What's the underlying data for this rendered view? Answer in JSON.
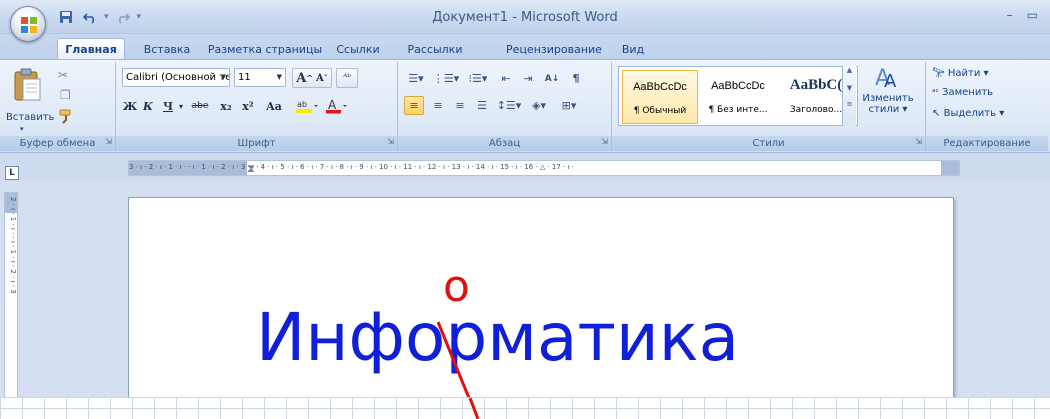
{
  "window": {
    "title": "Документ1 - Microsoft Word",
    "minimize_glyph": "–",
    "restore_glyph": "▭"
  },
  "quick_access": {
    "save_icon": "save-icon",
    "undo_icon": "undo-icon",
    "redo_icon": "redo-icon",
    "customize_glyph": "▾"
  },
  "tabs": [
    "Главная",
    "Вставка",
    "Разметка страницы",
    "Ссылки",
    "Рассылки",
    "Рецензирование",
    "Вид"
  ],
  "active_tab": "Главная",
  "clipboard": {
    "paste_label": "Вставить",
    "paste_arrow": "▾",
    "group_label": "Буфер обмена"
  },
  "font": {
    "font_name": "Calibri (Основной те",
    "font_size": "11",
    "grow": "A",
    "shrink": "A",
    "bold": "Ж",
    "italic": "К",
    "underline": "Ч",
    "strike": "abe",
    "subscript": "x₂",
    "superscript": "x²",
    "case": "Aa",
    "group_label": "Шрифт"
  },
  "paragraph": {
    "group_label": "Абзац"
  },
  "styles": {
    "items": [
      {
        "sample": "AaBbCcDc",
        "name": "¶ Обычный"
      },
      {
        "sample": "AaBbCcDc",
        "name": "¶ Без инте..."
      },
      {
        "sample": "AaBbC(",
        "name": "Заголово..."
      }
    ],
    "change_label_1": "Изменить",
    "change_label_2": "стили ▾",
    "group_label": "Стили"
  },
  "editing": {
    "find": "Найти ▾",
    "replace": "Заменить",
    "select": "Выделить ▾",
    "group_label": "Редактирование"
  },
  "ruler": {
    "corner_glyph": "L",
    "h_ticks": "3 · ı · 2 · ı · 1 · ı ·  · ı · 1 · ı · 2 · ı · 3 · ı · 4 · ı · 5 · ı · 6 · ı · 7 · ı · 8 · ı · 9 · ı · 10 · ı · 11 · ı · 12 · ı · 13 · ı · 14 · ı · 15 · ı · 16 · △ · 17 · ı ·",
    "v_ticks": "2 · ı · 1 · ı · · ı · 1 · ı · 2 · ı · 3"
  },
  "document": {
    "word": "Информатика",
    "correction": "о",
    "colors": {
      "word": "#1020d8",
      "correction": "#e01010"
    }
  }
}
